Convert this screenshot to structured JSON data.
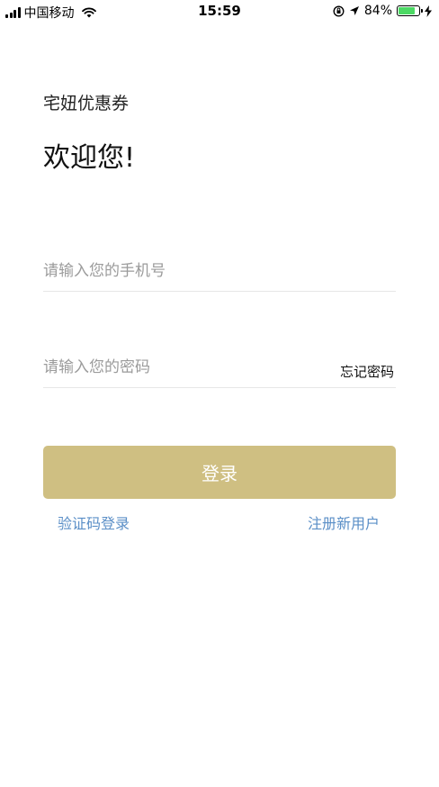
{
  "status_bar": {
    "carrier": "中国移动",
    "time": "15:59",
    "battery_percent": "84%",
    "battery_level": 0.84,
    "icons": [
      "signal-icon",
      "wifi-icon",
      "orientation-lock-icon",
      "location-icon",
      "battery-icon",
      "charging-icon"
    ],
    "battery_color": "#4cd964"
  },
  "header": {
    "app_name": "宅妞优惠券",
    "welcome": "欢迎您!"
  },
  "form": {
    "phone_placeholder": "请输入您的手机号",
    "phone_value": "",
    "password_placeholder": "请输入您的密码",
    "password_value": "",
    "forgot_label": "忘记密码"
  },
  "actions": {
    "login_label": "登录",
    "sms_login_label": "验证码登录",
    "register_label": "注册新用户"
  },
  "colors": {
    "accent": "#cfbf82",
    "link": "#5b8fc7",
    "divider": "#e7e7e7"
  }
}
